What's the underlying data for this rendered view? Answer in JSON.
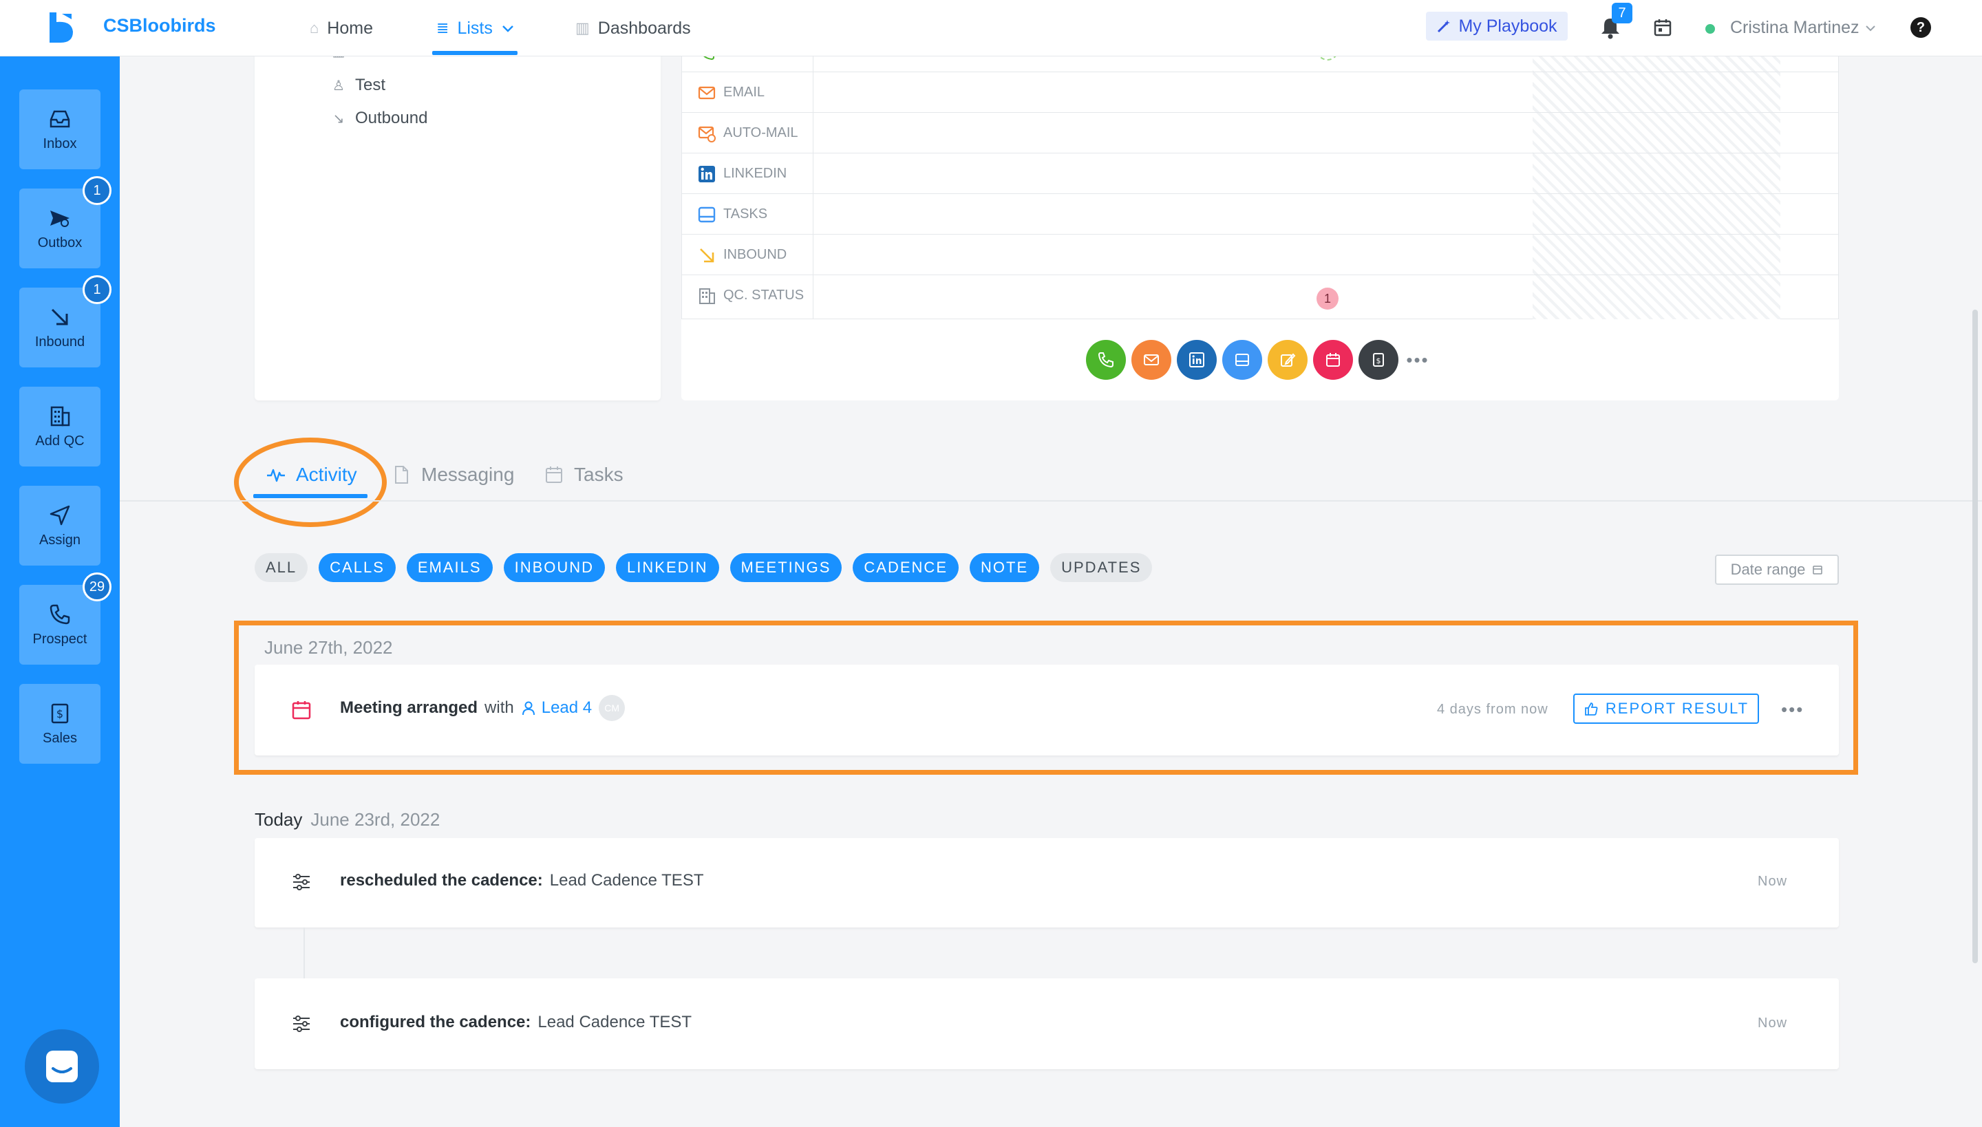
{
  "brand": {
    "name": "CSBloobirds"
  },
  "nav": {
    "home": "Home",
    "lists": "Lists",
    "dashboards": "Dashboards"
  },
  "header": {
    "playbook": "My Playbook",
    "notifications_count": "7",
    "user_name": "Cristina Martinez",
    "help": "?"
  },
  "sidebar": {
    "items": [
      {
        "label": "Inbox",
        "badge": ""
      },
      {
        "label": "Outbox",
        "badge": "1"
      },
      {
        "label": "Inbound",
        "badge": "1"
      },
      {
        "label": "Add QC",
        "badge": ""
      },
      {
        "label": "Assign",
        "badge": ""
      },
      {
        "label": "Prospect",
        "badge": "29"
      },
      {
        "label": "Sales",
        "badge": ""
      }
    ]
  },
  "left_panel": {
    "items": [
      "Test",
      "Test",
      "Outbound"
    ]
  },
  "grid": {
    "rows": [
      "CALL",
      "EMAIL",
      "AUTO-MAIL",
      "LINKEDIN",
      "TASKS",
      "INBOUND",
      "QC. STATUS"
    ],
    "qc_count": "1"
  },
  "actions": {
    "more": "•••"
  },
  "tabs": {
    "activity": "Activity",
    "messaging": "Messaging",
    "tasks": "Tasks"
  },
  "filters": {
    "chips": [
      "ALL",
      "CALLS",
      "EMAILS",
      "INBOUND",
      "LINKEDIN",
      "MEETINGS",
      "CADENCE",
      "NOTE",
      "UPDATES"
    ],
    "date_range": "Date range"
  },
  "timeline": {
    "upcoming": {
      "date": "June 27th, 2022",
      "title": "Meeting arranged",
      "with": "with",
      "lead": "Lead 4",
      "avatar": "CM",
      "time": "4 days from now",
      "report_button": "REPORT RESULT",
      "more": "•••"
    },
    "today": {
      "label": "Today",
      "date": "June 23rd, 2022",
      "items": [
        {
          "action": "rescheduled the cadence:",
          "target": "Lead Cadence TEST",
          "time": "Now"
        },
        {
          "action": "configured the cadence:",
          "target": "Lead Cadence TEST",
          "time": "Now"
        }
      ]
    }
  },
  "colors": {
    "primary": "#1991ff",
    "annotation": "#f7912a",
    "call": "#4cb52b",
    "email": "#f5843a",
    "linkedin": "#1d6bb5",
    "task": "#3f96f5",
    "note": "#f6b82d",
    "meeting": "#ed2a5a",
    "sales": "#3b4045"
  }
}
